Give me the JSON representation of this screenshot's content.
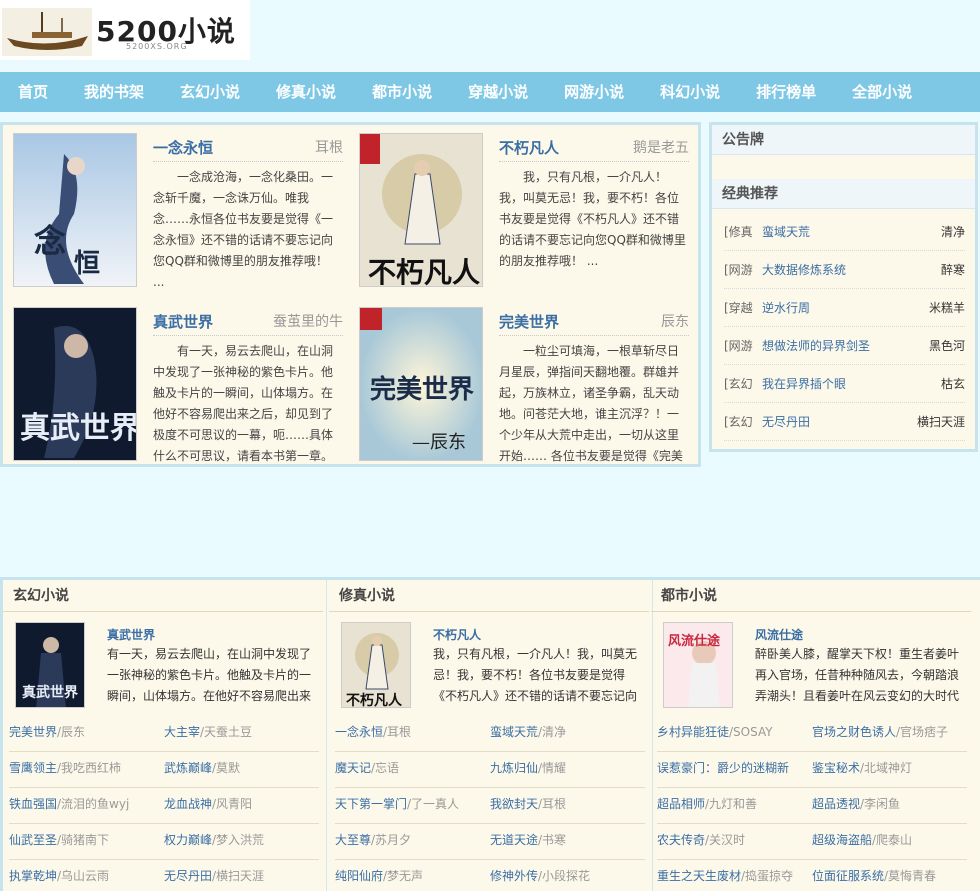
{
  "site": {
    "logo_text": "5200小说",
    "logo_sub": "5200XS.ORG"
  },
  "nav": [
    "首页",
    "我的书架",
    "玄幻小说",
    "修真小说",
    "都市小说",
    "穿越小说",
    "网游小说",
    "科幻小说",
    "排行榜单",
    "全部小说"
  ],
  "featured": [
    {
      "title": "一念永恒",
      "author": "耳根",
      "desc": "一念成沧海，一念化桑田。一念斩千魔，一念诛万仙。唯我念……永恒各位书友要是觉得《一念永恒》还不错的话请不要忘记向您QQ群和微博里的朋友推荐哦！ ...",
      "cover_text": "一念永恒"
    },
    {
      "title": "不朽凡人",
      "author": "鹅是老五",
      "desc": "我，只有凡根，一介凡人！我，叫莫无忌！我，要不朽！各位书友要是觉得《不朽凡人》还不错的话请不要忘记向您QQ群和微博里的朋友推荐哦！ ...",
      "cover_text": "不朽凡人"
    },
    {
      "title": "真武世界",
      "author": "蚕茧里的牛",
      "desc": "有一天，易云去爬山，在山洞中发现了一张神秘的紫色卡片。他触及卡片的一瞬间，山体塌方。在他好不容易爬出来之后，却见到了极度不可思议的一幕，呃……具体什么不可思议，请看本书第一章。",
      "cover_text": "真武世界"
    },
    {
      "title": "完美世界",
      "author": "辰东",
      "desc": "一粒尘可填海，一根草斩尽日月星辰，弹指间天翻地覆。群雄并起，万族林立，诸圣争霸，乱天动地。问苍茫大地，谁主沉浮？！一个少年从大荒中走出，一切从这里开始…… 各位书友要是觉得《完美",
      "cover_text": "完美世界"
    }
  ],
  "sidebar": {
    "notice_title": "公告牌",
    "recommend_title": "经典推荐",
    "items": [
      {
        "cat": "[修真",
        "name": "蛮域天荒",
        "author": "清净"
      },
      {
        "cat": "[网游",
        "name": "大数据修炼系统",
        "author": "醉寒"
      },
      {
        "cat": "[穿越",
        "name": "逆水行周",
        "author": "米糕羊"
      },
      {
        "cat": "[网游",
        "name": "想做法师的异界剑圣",
        "author": "黑色河"
      },
      {
        "cat": "[玄幻",
        "name": "我在异界插个眼",
        "author": "枯玄"
      },
      {
        "cat": "[玄幻",
        "name": "无尽丹田",
        "author": "横扫天涯"
      }
    ]
  },
  "categories": [
    {
      "title": "玄幻小说",
      "feat": {
        "title": "真武世界",
        "desc": "有一天，易云去爬山，在山洞中发现了一张神秘的紫色卡片。他触及卡片的一瞬间，山体塌方。在他好不容易爬出来之"
      },
      "rows": [
        [
          {
            "name": "完美世界",
            "author": "/辰东"
          },
          {
            "name": "大主宰",
            "author": "/天蚕土豆"
          }
        ],
        [
          {
            "name": "雪鹰领主",
            "author": "/我吃西红柿"
          },
          {
            "name": "武炼巅峰",
            "author": "/莫默"
          }
        ],
        [
          {
            "name": "铁血强国",
            "author": "/流泪的鱼wyj"
          },
          {
            "name": "龙血战神",
            "author": "/风青阳"
          }
        ],
        [
          {
            "name": "仙武至圣",
            "author": "/骑猪南下"
          },
          {
            "name": "权力巅峰",
            "author": "/梦入洪荒"
          }
        ],
        [
          {
            "name": "执掌乾坤",
            "author": "/乌山云雨"
          },
          {
            "name": "无尽丹田",
            "author": "/横扫天涯"
          }
        ]
      ]
    },
    {
      "title": "修真小说",
      "feat": {
        "title": "不朽凡人",
        "desc": "我，只有凡根，一介凡人！我，叫莫无忌！我，要不朽！各位书友要是觉得《不朽凡人》还不错的话请不要忘记向您QQ群"
      },
      "rows": [
        [
          {
            "name": "一念永恒",
            "author": "/耳根"
          },
          {
            "name": "蛮域天荒",
            "author": "/清净"
          }
        ],
        [
          {
            "name": "魔天记",
            "author": "/忘语"
          },
          {
            "name": "九炼归仙",
            "author": "/情耀"
          }
        ],
        [
          {
            "name": "天下第一掌门",
            "author": "/了一真人"
          },
          {
            "name": "我欲封天",
            "author": "/耳根"
          }
        ],
        [
          {
            "name": "大至尊",
            "author": "/苏月夕"
          },
          {
            "name": "无道天途",
            "author": "/书寒"
          }
        ],
        [
          {
            "name": "纯阳仙府",
            "author": "/梦无声"
          },
          {
            "name": "修神外传",
            "author": "/小段探花"
          }
        ]
      ]
    },
    {
      "title": "都市小说",
      "feat": {
        "title": "风流仕途",
        "desc": "醉卧美人膝，醒掌天下权！重生者姜叶再入官场，任昔种种随风去，今朝踏浪弄潮头！且看姜叶在风云变幻的大时代中，演"
      },
      "rows": [
        [
          {
            "name": "乡村异能狂徒",
            "author": "/SOSAY"
          },
          {
            "name": "官场之财色诱人",
            "author": "/官场痞子"
          }
        ],
        [
          {
            "name": "误惹豪门：爵少的迷糊新",
            "author": ""
          },
          {
            "name": "鉴宝秘术",
            "author": "/北域神灯"
          }
        ],
        [
          {
            "name": "超品相师",
            "author": "/九灯和善"
          },
          {
            "name": "超品透视",
            "author": "/李闲鱼"
          }
        ],
        [
          {
            "name": "农夫传奇",
            "author": "/关汉时"
          },
          {
            "name": "超级海盗船",
            "author": "/爬泰山"
          }
        ],
        [
          {
            "name": "重生之天生废材",
            "author": "/捣蛋掠夺"
          },
          {
            "name": "位面征服系统",
            "author": "/莫悔青春"
          }
        ]
      ]
    }
  ]
}
